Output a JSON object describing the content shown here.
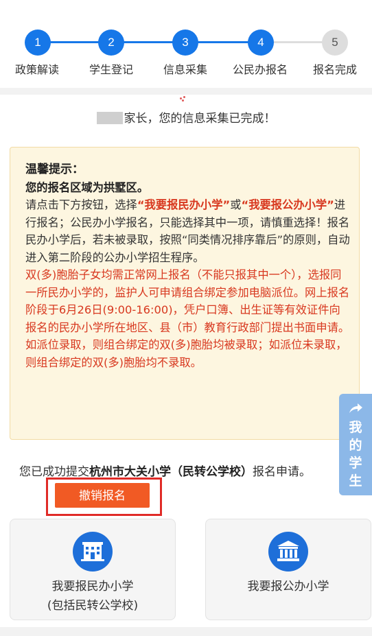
{
  "stepper": {
    "steps": [
      {
        "number": "1",
        "label": "政策解读",
        "state": "done"
      },
      {
        "number": "2",
        "label": "学生登记",
        "state": "done"
      },
      {
        "number": "3",
        "label": "信息采集",
        "state": "done"
      },
      {
        "number": "4",
        "label": "公民办报名",
        "state": "current"
      },
      {
        "number": "5",
        "label": "报名完成",
        "state": "pending"
      }
    ],
    "active_color": "#1677e8",
    "pending_color": "#dddddd"
  },
  "greeting": {
    "text": "家长，您的信息采集已完成！"
  },
  "tip": {
    "title": "温馨提示：",
    "region": "您的报名区域为拱墅区。",
    "p1_a": "请点击下方按钮，选择",
    "p1_option1": "“我要报民办小学”",
    "p1_or": "或",
    "p1_option2": "“我要报公办小学”",
    "p1_b": "进行报名；公民办小学报名，只能选择其中一项，请慎重选择！报名民办小学后，若未被录取，按照“同类情况排序靠后”的原则，自动进入第二阶段的公办小学招生程序。",
    "p2": "双(多)胞胎子女均需正常网上报名（不能只报其中一个），选报同一所民办小学的，监护人可申请组合绑定参加电脑派位。网上报名阶段于6月26日(9:00-16:00)，凭户口簿、出生证等有效证件向报名的民办小学所在地区、县（市）教育行政部门提出书面申请。如派位录取，则组合绑定的双(多)胞胎均被录取；如派位未录取，则组合绑定的双(多)胞胎均不录取。"
  },
  "side_tab": {
    "icon": "share-arrow-icon",
    "label": [
      "我",
      "的",
      "学",
      "生"
    ]
  },
  "submission": {
    "prefix": "您已成功提交",
    "school": "杭州市大关小学（民转公学校）",
    "suffix": "报名申请。",
    "cancel_label": "撤销报名"
  },
  "cards": [
    {
      "icon": "school-building-icon",
      "line1": "我要报民办小学",
      "line2": "(包括民转公学校)"
    },
    {
      "icon": "government-building-icon",
      "line1": "我要报公办小学",
      "line2": ""
    }
  ],
  "colors": {
    "accent_blue": "#1677e8",
    "highlight_red": "#d8381f",
    "cancel_orange": "#f15a24",
    "tip_background": "#fdf6e0"
  }
}
